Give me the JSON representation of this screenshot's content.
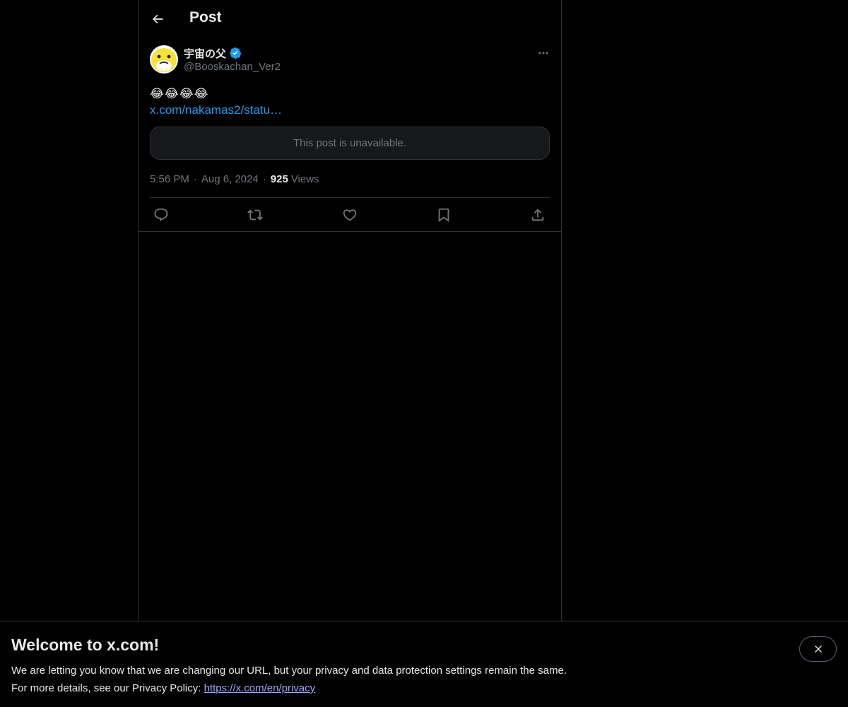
{
  "header": {
    "title": "Post",
    "back_icon": "arrow-left-icon"
  },
  "post": {
    "author": {
      "display_name": "宇宙の父",
      "handle": "@Booskachan_Ver2",
      "verified": true,
      "avatar_icon": "booska-avatar-icon"
    },
    "text_emojis": [
      "😂",
      "😂",
      "😂",
      "😂"
    ],
    "link_text": "x.com/nakamas2/statu…",
    "quote_unavailable_text": "This post is unavailable.",
    "time": "5:56 PM",
    "date": "Aug 6, 2024",
    "views_count": "925",
    "views_label": "Views",
    "meta_separator": "·"
  },
  "actions": {
    "reply_icon": "reply-icon",
    "repost_icon": "repost-icon",
    "like_icon": "heart-icon",
    "bookmark_icon": "bookmark-icon",
    "share_icon": "share-icon"
  },
  "banner": {
    "title": "Welcome to x.com!",
    "line1": "We are letting you know that we are changing our URL, but your privacy and data protection settings remain the same.",
    "line2_prefix": "For more details, see our Privacy Policy: ",
    "privacy_link": "https://x.com/en/privacy",
    "close_icon": "close-icon"
  },
  "colors": {
    "background": "#000000",
    "accent_blue": "#1d9bf0",
    "text_primary": "#e7e9ea",
    "text_secondary": "#71767b",
    "border": "#2f3336",
    "link_purple": "#a0a4ff"
  }
}
